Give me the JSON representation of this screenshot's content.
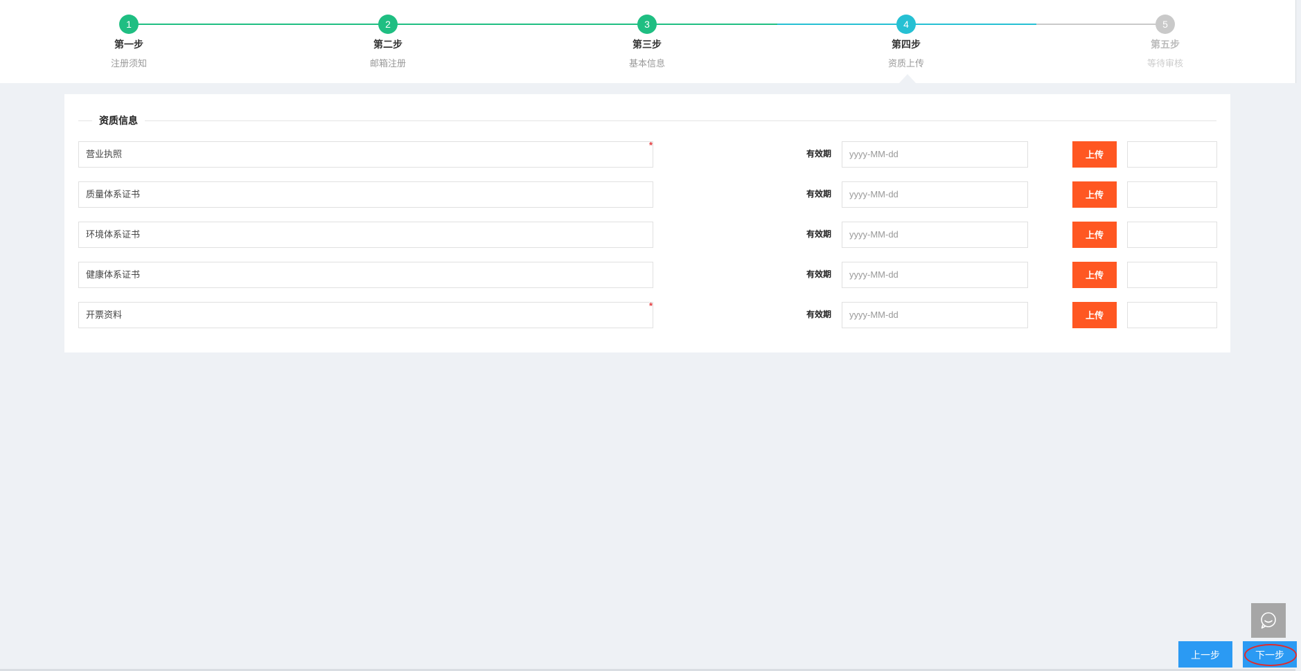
{
  "stepper": {
    "steps": [
      {
        "number": "1",
        "title": "第一步",
        "desc": "注册须知",
        "status": "done"
      },
      {
        "number": "2",
        "title": "第二步",
        "desc": "邮箱注册",
        "status": "done"
      },
      {
        "number": "3",
        "title": "第三步",
        "desc": "基本信息",
        "status": "done"
      },
      {
        "number": "4",
        "title": "第四步",
        "desc": "资质上传",
        "status": "current"
      },
      {
        "number": "5",
        "title": "第五步",
        "desc": "等待审核",
        "status": "pending"
      }
    ],
    "colors": {
      "done": "#1fbe82",
      "current": "#26c0d3",
      "pending": "#c9c9c9"
    }
  },
  "section": {
    "title": "资质信息"
  },
  "rows": [
    {
      "name": "营业执照",
      "required": true
    },
    {
      "name": "质量体系证书",
      "required": false
    },
    {
      "name": "环境体系证书",
      "required": false
    },
    {
      "name": "健康体系证书",
      "required": false
    },
    {
      "name": "开票资料",
      "required": true
    }
  ],
  "labels": {
    "expiry": "有效期",
    "date_placeholder": "yyyy-MM-dd",
    "upload": "上传",
    "required_mark": "*"
  },
  "footer": {
    "prev": "上一步",
    "next": "下一步"
  },
  "colors": {
    "upload_button": "#ff5722",
    "nav_button": "#2b9af3",
    "highlight": "#e02b2b"
  },
  "icons": {
    "chat": "chat-bubble-icon"
  }
}
